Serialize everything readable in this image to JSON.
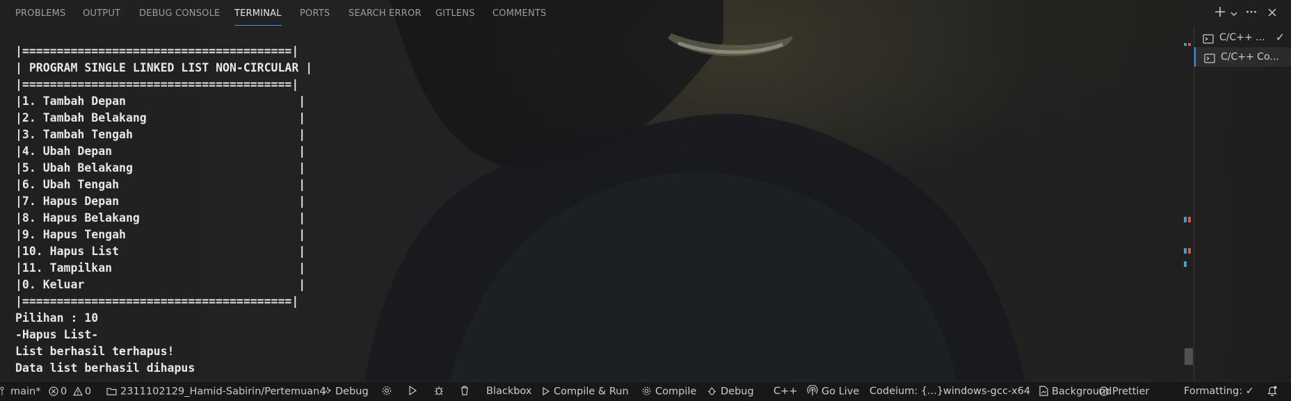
{
  "panel": {
    "tabs": [
      {
        "label": "PROBLEMS",
        "active": false
      },
      {
        "label": "OUTPUT",
        "active": false
      },
      {
        "label": "DEBUG CONSOLE",
        "active": false
      },
      {
        "label": "TERMINAL",
        "active": true
      },
      {
        "label": "PORTS",
        "active": false
      },
      {
        "label": "SEARCH ERROR",
        "active": false
      },
      {
        "label": "GITLENS",
        "active": false
      },
      {
        "label": "COMMENTS",
        "active": false
      }
    ],
    "actions": [
      "new-terminal-plus-icon",
      "chevron-down-icon",
      "more-icon",
      "close-icon"
    ]
  },
  "terminal": {
    "lines": [
      "|=======================================|",
      "| PROGRAM SINGLE LINKED LIST NON-CIRCULAR |",
      "|=======================================|",
      "|1. Tambah Depan                         |",
      "|2. Tambah Belakang                      |",
      "|3. Tambah Tengah                        |",
      "|4. Ubah Depan                           |",
      "|5. Ubah Belakang                        |",
      "|6. Ubah Tengah                          |",
      "|7. Hapus Depan                          |",
      "|8. Hapus Belakang                       |",
      "|9. Hapus Tengah                         |",
      "|10. Hapus List                          |",
      "|11. Tampilkan                           |",
      "|0. Keluar                               |",
      "|=======================================|",
      "Pilihan : 10",
      "-Hapus List-",
      "List berhasil terhapus!",
      "Data list berhasil dihapus"
    ]
  },
  "terminal_list": [
    {
      "label": "C/C++ ...",
      "icon": "terminal-icon",
      "check": "✓",
      "active": false
    },
    {
      "label": "C/C++ Co...",
      "icon": "terminal-icon",
      "check": "",
      "active": true
    }
  ],
  "statusbar": {
    "branch": "main*",
    "errors": "0",
    "warnings": "0",
    "workspace": "2311102129_Hamid-Sabirin/Pertemuan4",
    "debug": "Debug",
    "blackbox": "Blackbox",
    "compile_run": "Compile & Run",
    "compile": "Compile",
    "debug2": "Debug",
    "language": "C++",
    "golive": "Go Live",
    "codeium": "Codeium: {...}",
    "config": "windows-gcc-x64",
    "background": "Background",
    "prettier": "Prettier",
    "formatting": "Formatting: ✓"
  },
  "colors": {
    "accent": "#3794ff",
    "marker_blue": "#3aa3c7",
    "marker_red": "#e05252"
  }
}
